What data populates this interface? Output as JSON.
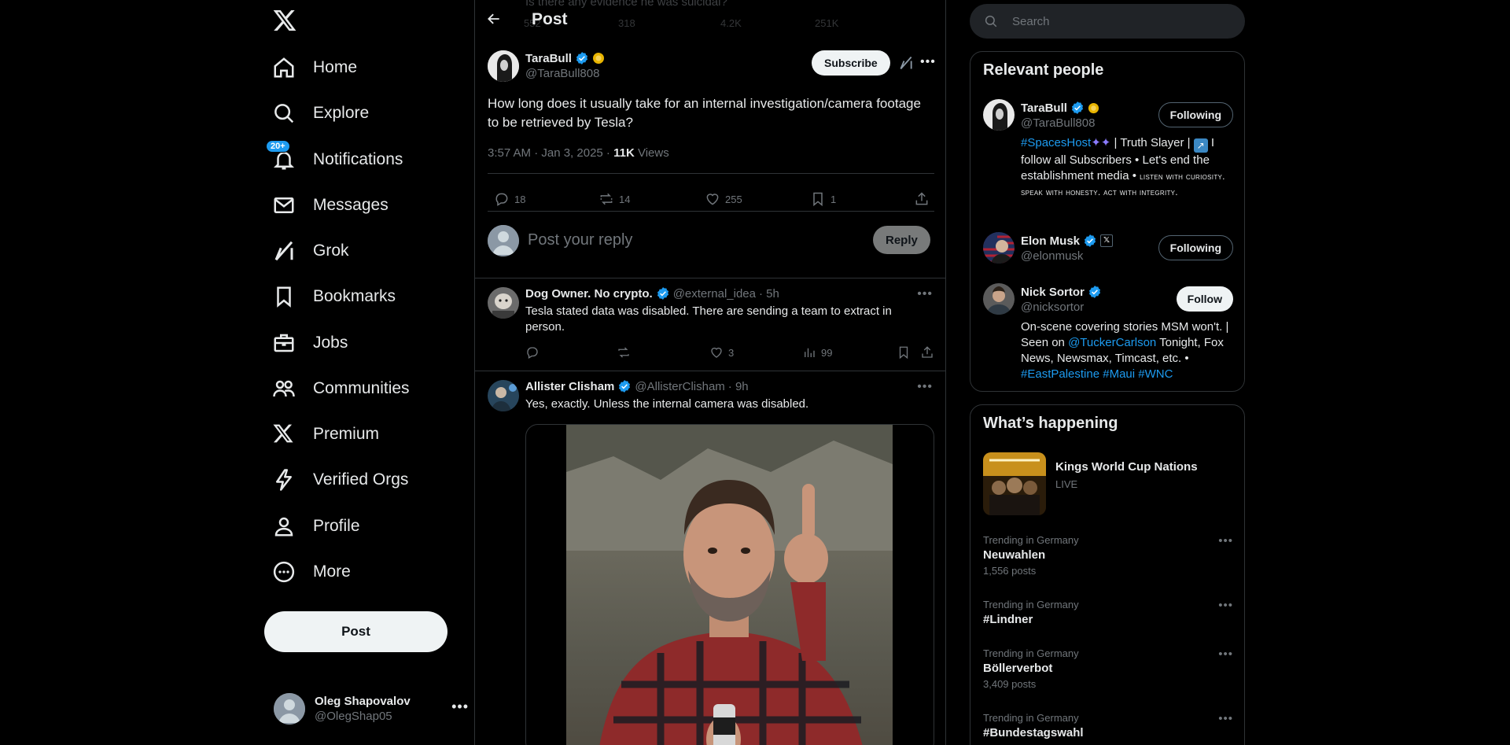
{
  "nav": {
    "items": [
      {
        "label": "Home",
        "icon": "home-icon"
      },
      {
        "label": "Explore",
        "icon": "search-icon"
      },
      {
        "label": "Notifications",
        "icon": "bell-icon",
        "badge": "20+"
      },
      {
        "label": "Messages",
        "icon": "envelope-icon"
      },
      {
        "label": "Grok",
        "icon": "grok-icon"
      },
      {
        "label": "Bookmarks",
        "icon": "bookmark-icon"
      },
      {
        "label": "Jobs",
        "icon": "briefcase-icon"
      },
      {
        "label": "Communities",
        "icon": "people-icon"
      },
      {
        "label": "Premium",
        "icon": "x-logo-icon"
      },
      {
        "label": "Verified Orgs",
        "icon": "lightning-icon"
      },
      {
        "label": "Profile",
        "icon": "person-icon"
      },
      {
        "label": "More",
        "icon": "more-circle-icon"
      }
    ],
    "post_label": "Post",
    "account": {
      "name": "Oleg Shapovalov",
      "handle": "@OlegShap05"
    }
  },
  "header": {
    "title": "Post",
    "ghost_text": "Is there any evidence he was suicidal?",
    "ghost_counts": {
      "reposts": "318",
      "likes": "4.2K",
      "views": "251K",
      "replies": "552"
    }
  },
  "main_tweet": {
    "name": "TaraBull",
    "handle": "@TaraBull808",
    "subscribe_label": "Subscribe",
    "text": "How long does it usually take for an internal investigation/camera footage to be retrieved by Tesla?",
    "time": "3:57 AM · Jan 3, 2025 · ",
    "views_count": "11K",
    "views_label": " Views",
    "replies": "18",
    "reposts": "14",
    "likes": "255",
    "bookmarks": "1"
  },
  "reply_box": {
    "placeholder": "Post your reply",
    "button": "Reply"
  },
  "replies": [
    {
      "name": "Dog Owner. No crypto.",
      "handle": "@external_idea",
      "time": "· 5h",
      "text": "Tesla stated data was disabled. There are sending a team to extract in person.",
      "likes": "3",
      "views": "99"
    },
    {
      "name": "Allister Clisham",
      "handle": "@AllisterClisham",
      "time": "· 9h",
      "text": "Yes, exactly.  Unless the internal camera was disabled."
    }
  ],
  "search": {
    "placeholder": "Search"
  },
  "relevant": {
    "title": "Relevant people",
    "people": [
      {
        "name": "TaraBull",
        "handle": "@TaraBull808",
        "button": "Following",
        "bio_tag": "#SpacesHost",
        "bio_mid": " | Truth Slayer | ",
        "bio_rest": " I follow all Subscribers • Let's end the establishment media • ",
        "bio_small": "listen with curiosity. speak with honesty. act with integrity."
      },
      {
        "name": "Elon Musk",
        "handle": "@elonmusk",
        "button": "Following"
      },
      {
        "name": "Nick Sortor",
        "handle": "@nicksortor",
        "button": "Follow",
        "bio_a": "On-scene covering stories MSM won't. | Seen on ",
        "bio_link": "@TuckerCarlson",
        "bio_b": " Tonight, Fox News, Newsmax, Timcast, etc. • ",
        "bio_tags": "#EastPalestine #Maui #WNC"
      }
    ]
  },
  "happening": {
    "title": "What’s happening",
    "event": {
      "title": "Kings World Cup Nations",
      "status": "LIVE"
    },
    "trends": [
      {
        "category": "Trending in Germany",
        "title": "Neuwahlen",
        "count": "1,556 posts"
      },
      {
        "category": "Trending in Germany",
        "title": "#Lindner",
        "count": ""
      },
      {
        "category": "Trending in Germany",
        "title": "Böllerverbot",
        "count": "3,409 posts"
      },
      {
        "category": "Trending in Germany",
        "title": "#Bundestagswahl",
        "count": ""
      }
    ]
  },
  "colors": {
    "accent": "#1d9bf0",
    "background": "#000000",
    "border": "#2f3336",
    "muted": "#71767b",
    "text": "#e7e9ea",
    "gold_badge": "#e8b400"
  }
}
